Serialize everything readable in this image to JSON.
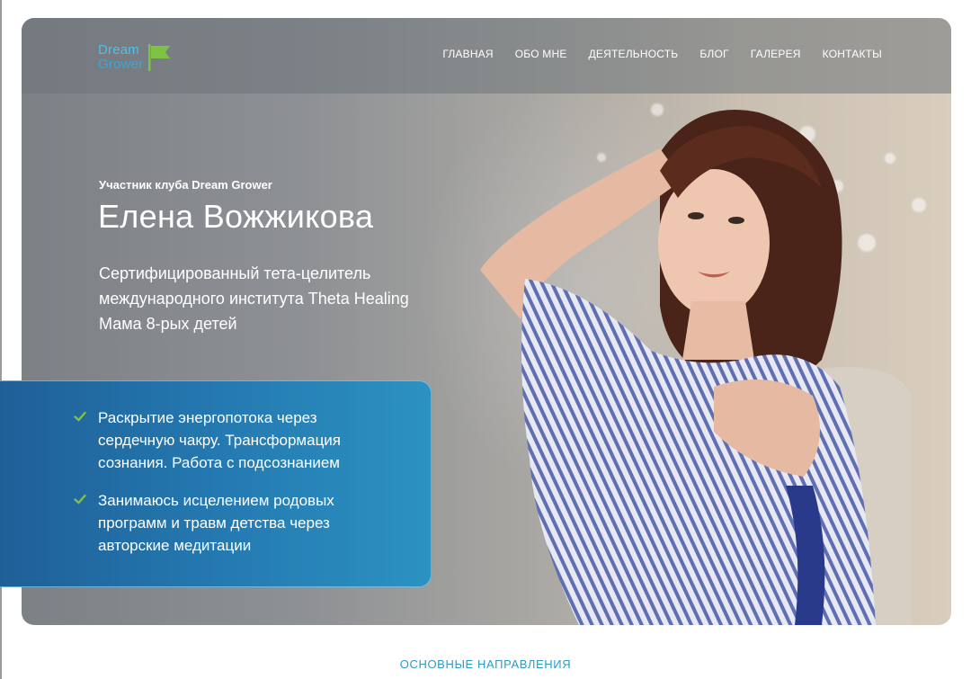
{
  "logo": {
    "line1": "Dream",
    "line2": "Grower",
    "accent": "#7dc243",
    "text_color": "#4fc0e8"
  },
  "nav": {
    "items": [
      "ГЛАВНАЯ",
      "ОБО МНЕ",
      "ДЕЯТЕЛЬНОСТЬ",
      "БЛОГ",
      "ГАЛЕРЕЯ",
      "КОНТАКТЫ"
    ]
  },
  "hero": {
    "subtitle": "Участник клуба Dream Grower",
    "name": "Елена Вожжикова",
    "description": [
      "Сертифицированный тета-целитель",
      "международного института Theta Healing",
      "Мама 8-рых детей"
    ]
  },
  "info_box": {
    "check_color": "#7dc243",
    "bullets": [
      {
        "lines": [
          "Раскрытие энергопотока через",
          "сердечную чакру. Трансформация",
          "сознания. Работа с подсознанием"
        ]
      },
      {
        "lines": [
          "Занимаюсь исцелением родовых",
          "программ и травм детства через",
          "авторские медитации"
        ]
      }
    ]
  },
  "section": {
    "title": "ОСНОВНЫЕ НАПРАВЛЕНИЯ"
  }
}
